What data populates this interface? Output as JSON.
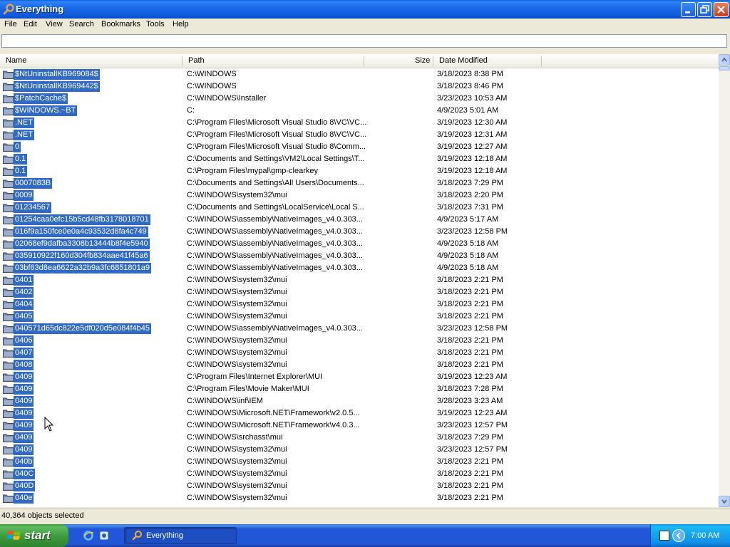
{
  "window": {
    "title": "Everything",
    "controls": {
      "minimize": "minimize-icon",
      "maximize": "restore-icon",
      "close": "close-icon"
    }
  },
  "menu": [
    "File",
    "Edit",
    "View",
    "Search",
    "Bookmarks",
    "Tools",
    "Help"
  ],
  "search": {
    "value": "",
    "placeholder": ""
  },
  "columns": {
    "name": "Name",
    "path": "Path",
    "size": "Size",
    "date": "Date Modified"
  },
  "rows": [
    {
      "name": "$NtUninstallKB969084$",
      "path": "C:\\WINDOWS",
      "date": "3/18/2023 8:38 PM"
    },
    {
      "name": "$NtUninstallKB969442$",
      "path": "C:\\WINDOWS",
      "date": "3/18/2023 8:46 PM"
    },
    {
      "name": "$PatchCache$",
      "path": "C:\\WINDOWS\\Installer",
      "date": "3/23/2023 10:53 AM"
    },
    {
      "name": "$WINDOWS.~BT",
      "path": "C:",
      "date": "4/9/2023 5:01 AM"
    },
    {
      "name": ".NET",
      "path": "C:\\Program Files\\Microsoft Visual Studio 8\\VC\\VC...",
      "date": "3/19/2023 12:30 AM"
    },
    {
      "name": ".NET",
      "path": "C:\\Program Files\\Microsoft Visual Studio 8\\VC\\VC...",
      "date": "3/19/2023 12:31 AM"
    },
    {
      "name": "0",
      "path": "C:\\Program Files\\Microsoft Visual Studio 8\\Comm...",
      "date": "3/19/2023 12:27 AM"
    },
    {
      "name": "0.1",
      "path": "C:\\Documents and Settings\\VM2\\Local Settings\\T...",
      "date": "3/19/2023 12:18 AM"
    },
    {
      "name": "0.1",
      "path": "C:\\Program Files\\mypal\\gmp-clearkey",
      "date": "3/19/2023 12:18 AM"
    },
    {
      "name": "0007083B",
      "path": "C:\\Documents and Settings\\All Users\\Documents...",
      "date": "3/18/2023 7:29 PM"
    },
    {
      "name": "0009",
      "path": "C:\\WINDOWS\\system32\\mui",
      "date": "3/18/2023 2:20 PM"
    },
    {
      "name": "01234567",
      "path": "C:\\Documents and Settings\\LocalService\\Local S...",
      "date": "3/18/2023 7:31 PM"
    },
    {
      "name": "01254caa0efc15b5cd48fb3178018701",
      "path": "C:\\WINDOWS\\assembly\\NativeImages_v4.0.303...",
      "date": "4/9/2023 5:17 AM"
    },
    {
      "name": "016f9a150fce0e0a4c93532d8fa4c749",
      "path": "C:\\WINDOWS\\assembly\\NativeImages_v4.0.303...",
      "date": "3/23/2023 12:58 PM"
    },
    {
      "name": "02068ef9dafba3308b13444b8f4e5940",
      "path": "C:\\WINDOWS\\assembly\\NativeImages_v4.0.303...",
      "date": "4/9/2023 5:18 AM"
    },
    {
      "name": "035910922f160d304fb834aae41f45a6",
      "path": "C:\\WINDOWS\\assembly\\NativeImages_v4.0.303...",
      "date": "4/9/2023 5:18 AM"
    },
    {
      "name": "03bf63d8ea6622a32b9a3fc6851801a9",
      "path": "C:\\WINDOWS\\assembly\\NativeImages_v4.0.303...",
      "date": "4/9/2023 5:18 AM"
    },
    {
      "name": "0401",
      "path": "C:\\WINDOWS\\system32\\mui",
      "date": "3/18/2023 2:21 PM"
    },
    {
      "name": "0402",
      "path": "C:\\WINDOWS\\system32\\mui",
      "date": "3/18/2023 2:21 PM"
    },
    {
      "name": "0404",
      "path": "C:\\WINDOWS\\system32\\mui",
      "date": "3/18/2023 2:21 PM"
    },
    {
      "name": "0405",
      "path": "C:\\WINDOWS\\system32\\mui",
      "date": "3/18/2023 2:21 PM"
    },
    {
      "name": "040571d65dc822e5df020d5e084f4b45",
      "path": "C:\\WINDOWS\\assembly\\NativeImages_v4.0.303...",
      "date": "3/23/2023 12:58 PM"
    },
    {
      "name": "0406",
      "path": "C:\\WINDOWS\\system32\\mui",
      "date": "3/18/2023 2:21 PM"
    },
    {
      "name": "0407",
      "path": "C:\\WINDOWS\\system32\\mui",
      "date": "3/18/2023 2:21 PM"
    },
    {
      "name": "0408",
      "path": "C:\\WINDOWS\\system32\\mui",
      "date": "3/18/2023 2:21 PM"
    },
    {
      "name": "0409",
      "path": "C:\\Program Files\\Internet Explorer\\MUI",
      "date": "3/19/2023 12:23 AM"
    },
    {
      "name": "0409",
      "path": "C:\\Program Files\\Movie Maker\\MUI",
      "date": "3/18/2023 7:28 PM"
    },
    {
      "name": "0409",
      "path": "C:\\WINDOWS\\inf\\IEM",
      "date": "3/28/2023 3:23 AM"
    },
    {
      "name": "0409",
      "path": "C:\\WINDOWS\\Microsoft.NET\\Framework\\v2.0.5...",
      "date": "3/19/2023 12:23 AM"
    },
    {
      "name": "0409",
      "path": "C:\\WINDOWS\\Microsoft.NET\\Framework\\v4.0.3...",
      "date": "3/23/2023 12:57 PM"
    },
    {
      "name": "0409",
      "path": "C:\\WINDOWS\\srchasst\\mui",
      "date": "3/18/2023 7:29 PM"
    },
    {
      "name": "0409",
      "path": "C:\\WINDOWS\\system32\\mui",
      "date": "3/23/2023 12:57 PM"
    },
    {
      "name": "040b",
      "path": "C:\\WINDOWS\\system32\\mui",
      "date": "3/18/2023 2:21 PM"
    },
    {
      "name": "040C",
      "path": "C:\\WINDOWS\\system32\\mui",
      "date": "3/18/2023 2:21 PM"
    },
    {
      "name": "040D",
      "path": "C:\\WINDOWS\\system32\\mui",
      "date": "3/18/2023 2:21 PM"
    },
    {
      "name": "040e",
      "path": "C:\\WINDOWS\\system32\\mui",
      "date": "3/18/2023 2:21 PM"
    }
  ],
  "status": {
    "text": "40,364 objects selected"
  },
  "taskbar": {
    "start_label": "start",
    "task_label": "Everything",
    "clock": "7:00 AM"
  },
  "colors": {
    "selection": "#316AC5",
    "titlebar": "#0A5FDE",
    "taskbar": "#2157D7",
    "start": "#3B9A3B"
  }
}
